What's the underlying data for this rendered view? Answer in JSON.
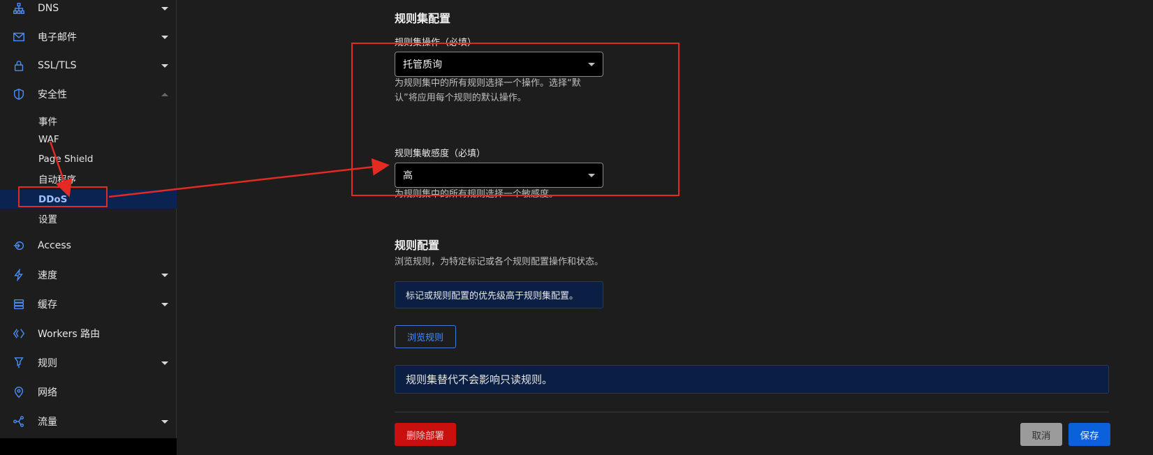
{
  "sidebar": {
    "items": [
      {
        "label": "DNS",
        "icon": "dns-network-icon"
      },
      {
        "label": "电子邮件",
        "icon": "email-icon"
      },
      {
        "label": "SSL/TLS",
        "icon": "lock-icon"
      },
      {
        "label": "安全性",
        "icon": "shield-icon"
      },
      {
        "label": "Access",
        "icon": "access-icon"
      },
      {
        "label": "速度",
        "icon": "lightning-icon"
      },
      {
        "label": "缓存",
        "icon": "cache-icon"
      },
      {
        "label": "Workers 路由",
        "icon": "workers-icon"
      },
      {
        "label": "规则",
        "icon": "rules-icon"
      },
      {
        "label": "网络",
        "icon": "location-pin-icon"
      },
      {
        "label": "流量",
        "icon": "traffic-icon"
      }
    ],
    "security_sub": [
      "事件",
      "WAF",
      "Page Shield",
      "自动程序",
      "DDoS",
      "设置"
    ],
    "active_sub": "DDoS"
  },
  "main": {
    "ruleset_section_title": "规则集配置",
    "action_label": "规则集操作（必填）",
    "action_value": "托管质询",
    "action_help_line1": "为规则集中的所有规则选择一个操作。选择“默",
    "action_help_line2": "认”将应用每个规则的默认操作。",
    "sensitivity_label": "规则集敏感度（必填）",
    "sensitivity_value": "高",
    "sensitivity_help": "为规则集中的所有规则选择一个敏感度。",
    "rule_config_title": "规则配置",
    "rule_config_desc": "浏览规则，为特定标记或各个规则配置操作和状态。",
    "info_priority": "标记或规则配置的优先级高于规则集配置。",
    "browse_button": "浏览规则",
    "info_readonly": "规则集替代不会影响只读规则。",
    "delete_button": "删除部署",
    "cancel_button": "取消",
    "save_button": "保存"
  },
  "colors": {
    "accent": "#4b8bf5",
    "annotation": "#e32a23",
    "delete": "#c8100f",
    "save": "#0b61d9"
  }
}
